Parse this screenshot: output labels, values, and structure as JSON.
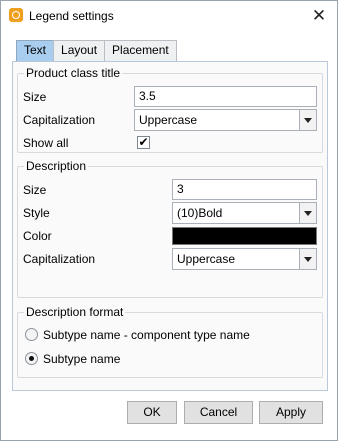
{
  "window": {
    "title": "Legend settings",
    "close_glyph": "✕",
    "app_icon": "app-icon"
  },
  "tabs": [
    {
      "label": "Text",
      "active": true
    },
    {
      "label": "Layout",
      "active": false
    },
    {
      "label": "Placement",
      "active": false
    }
  ],
  "product_class_title": {
    "title": "Product class title",
    "size_label": "Size",
    "size_value": "3.5",
    "capitalization_label": "Capitalization",
    "capitalization_value": "Uppercase",
    "show_all_label": "Show all",
    "show_all_checked": true,
    "check_glyph": "✔"
  },
  "description": {
    "title": "Description",
    "size_label": "Size",
    "size_value": "3",
    "style_label": "Style",
    "style_value": "(10)Bold",
    "color_label": "Color",
    "color_value": "#000000",
    "capitalization_label": "Capitalization",
    "capitalization_value": "Uppercase"
  },
  "description_format": {
    "title": "Description format",
    "options": [
      {
        "label": "Subtype name - component type name",
        "selected": false
      },
      {
        "label": "Subtype name",
        "selected": true
      }
    ]
  },
  "buttons": {
    "ok": "OK",
    "cancel": "Cancel",
    "apply": "Apply"
  }
}
